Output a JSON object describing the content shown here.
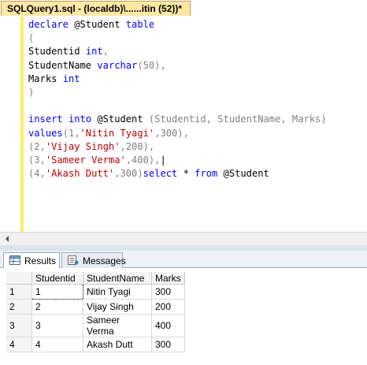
{
  "editor_tab": {
    "title": "SQLQuery1.sql - (localdb)\\......itin (52))*"
  },
  "code": {
    "l1": [
      "declare",
      " @Student ",
      "table"
    ],
    "l2": "(",
    "l3": [
      "Studentid ",
      "int",
      ","
    ],
    "l4": [
      "StudentName ",
      "varchar",
      "(50)",
      ","
    ],
    "l5": [
      "Marks ",
      "int"
    ],
    "l6": ")",
    "l8": [
      "insert",
      " ",
      "into",
      " @Student ",
      "(Studentid, StudentName, Marks)"
    ],
    "l9": [
      "values",
      "(1,",
      "'Nitin Tyagi'",
      ",300),"
    ],
    "l10": [
      "(2,",
      "'Vijay Singh'",
      ",200),"
    ],
    "l11": [
      "(3,",
      "'Sameer Verma'",
      ",400),"
    ],
    "l12": [
      "(4,",
      "'Akash Dutt'",
      ",300)"
    ],
    "l16": [
      "select",
      " * ",
      "from",
      " @Student"
    ]
  },
  "results_tabs": {
    "results": "Results",
    "messages": "Messages"
  },
  "grid": {
    "columns": [
      "Studentid",
      "StudentName",
      "Marks"
    ],
    "rows": [
      {
        "num": "1",
        "cells": [
          "1",
          "Nitin Tyagi",
          "300"
        ]
      },
      {
        "num": "2",
        "cells": [
          "2",
          "Vijay Singh",
          "200"
        ]
      },
      {
        "num": "3",
        "cells": [
          "3",
          "Sameer Verma",
          "400"
        ]
      },
      {
        "num": "4",
        "cells": [
          "4",
          "Akash Dutt",
          "300"
        ]
      }
    ]
  },
  "colors": {
    "keyword": "#0000ff",
    "string": "#b90000",
    "punct": "#808080",
    "tab_active": "#ffe8a6"
  },
  "icons": [
    "results-grid-icon",
    "messages-icon",
    "scroll-left-arrow-icon"
  ]
}
